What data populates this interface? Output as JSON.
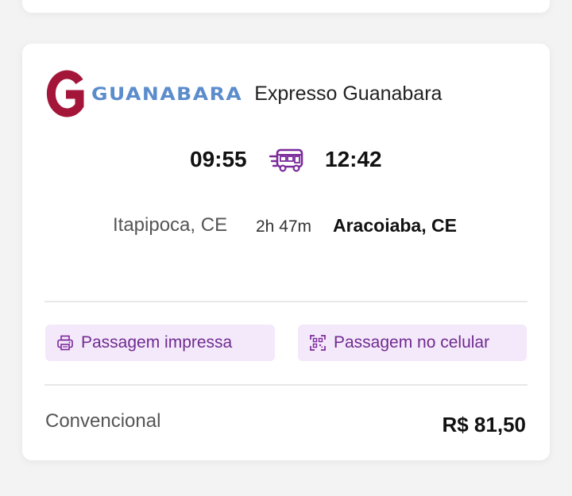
{
  "company": {
    "logo_letter": "G",
    "logo_text": "GUANABARA",
    "name": "Expresso Guanabara",
    "colors": {
      "logo_g": "#a3163a",
      "logo_text": "#5b8ccc"
    }
  },
  "trip": {
    "departure_time": "09:55",
    "arrival_time": "12:42",
    "origin": "Itapipoca, CE",
    "duration": "2h 47m",
    "destination": "Aracoiaba, CE",
    "vehicle_icon": "bus-icon"
  },
  "ticket_options": [
    {
      "label": "Passagem impressa",
      "icon": "printer-icon"
    },
    {
      "label": "Passagem no celular",
      "icon": "qr-code-icon"
    }
  ],
  "fare": {
    "class": "Convencional",
    "price": "R$ 81,50"
  },
  "colors": {
    "accent": "#7b2a9b",
    "pill_bg": "#f4e8fb"
  }
}
